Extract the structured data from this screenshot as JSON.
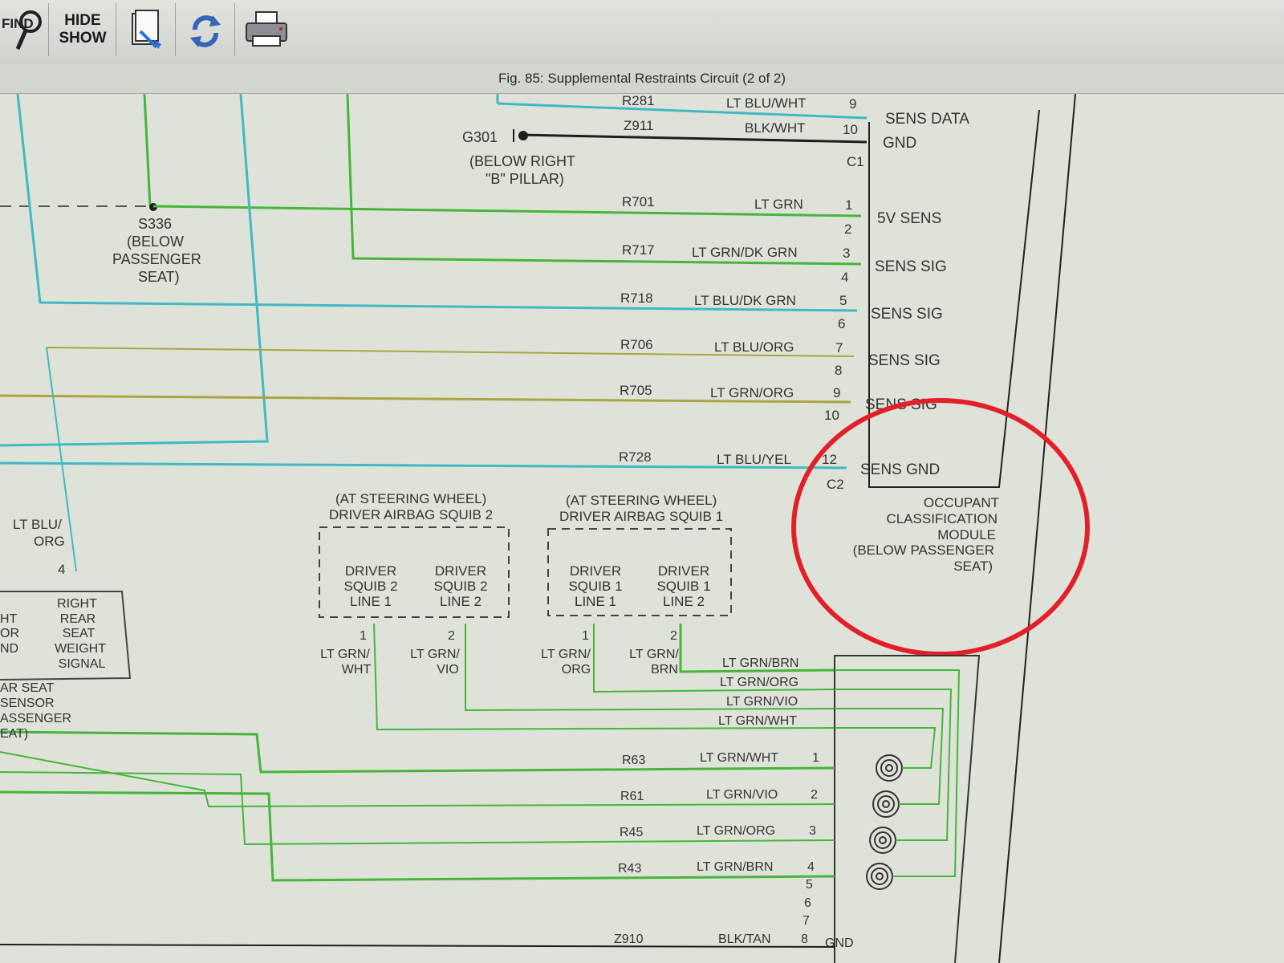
{
  "toolbar": {
    "find_label": "FIND",
    "hide_label": "HIDE",
    "show_label": "SHOW"
  },
  "figure_title": "Fig. 85: Supplemental Restraints Circuit (2 of 2)",
  "colors": {
    "wire_green": "#46b53a",
    "wire_cyan": "#3fb9c2",
    "wire_olive": "#a9a542",
    "wire_black": "#1d1d1d",
    "highlight_red": "#e2202a"
  },
  "connector_c1": {
    "label": "C1",
    "pins": [
      {
        "wire": "R281",
        "color": "LT BLU/WHT",
        "pin": "9",
        "signal": "SENS DATA"
      },
      {
        "wire": "Z911",
        "color": "BLK/WHT",
        "pin": "10",
        "signal": "GND"
      }
    ]
  },
  "connector_c2": {
    "label": "C2",
    "pins": [
      {
        "wire": "R701",
        "color": "LT GRN",
        "pin": "1",
        "signal": "5V SENS"
      },
      {
        "pin": "2"
      },
      {
        "wire": "R717",
        "color": "LT GRN/DK GRN",
        "pin": "3",
        "signal": "SENS SIG"
      },
      {
        "pin": "4"
      },
      {
        "wire": "R718",
        "color": "LT BLU/DK GRN",
        "pin": "5",
        "signal": "SENS SIG"
      },
      {
        "pin": "6"
      },
      {
        "wire": "R706",
        "color": "LT BLU/ORG",
        "pin": "7",
        "signal": "SENS SIG"
      },
      {
        "pin": "8"
      },
      {
        "wire": "R705",
        "color": "LT GRN/ORG",
        "pin": "9",
        "signal": "SENS SIG"
      },
      {
        "pin": "10"
      },
      {
        "wire": "R728",
        "color": "LT BLU/YEL",
        "pin": "12",
        "signal": "SENS GND"
      }
    ]
  },
  "ground_g301": {
    "id": "G301",
    "loc1": "(BELOW RIGHT",
    "loc2": "\"B\" PILLAR)"
  },
  "splice_s336": {
    "id": "S336",
    "l1": "(BELOW",
    "l2": "PASSENGER",
    "l3": "SEAT)"
  },
  "occupant_module": {
    "l1": "OCCUPANT",
    "l2": "CLASSIFICATION",
    "l3": "MODULE",
    "l4": "(BELOW PASSENGER",
    "l5": "SEAT)"
  },
  "squib2": {
    "location": "(AT STEERING WHEEL)",
    "name": "DRIVER AIRBAG SQUIB 2",
    "line1": [
      "DRIVER",
      "SQUIB 2",
      "LINE 1"
    ],
    "line2": [
      "DRIVER",
      "SQUIB 2",
      "LINE 2"
    ],
    "pin1": "1",
    "pin2": "2",
    "wire1": [
      "LT GRN/",
      "WHT"
    ],
    "wire2": [
      "LT GRN/",
      "VIO"
    ]
  },
  "squib1": {
    "location": "(AT STEERING WHEEL)",
    "name": "DRIVER AIRBAG SQUIB 1",
    "line1": [
      "DRIVER",
      "SQUIB 1",
      "LINE 1"
    ],
    "line2": [
      "DRIVER",
      "SQUIB 1",
      "LINE 2"
    ],
    "pin1": "1",
    "pin2": "2",
    "wire1": [
      "LT GRN/",
      "ORG"
    ],
    "wire2": [
      "LT GRN/",
      "BRN"
    ]
  },
  "clockspring_labels": [
    "LT GRN/BRN",
    "LT GRN/ORG",
    "LT GRN/VIO",
    "LT GRN/WHT"
  ],
  "clockspring_pins": [
    {
      "wire": "R63",
      "color": "LT GRN/WHT",
      "pin": "1"
    },
    {
      "wire": "R61",
      "color": "LT GRN/VIO",
      "pin": "2"
    },
    {
      "wire": "R45",
      "color": "LT GRN/ORG",
      "pin": "3"
    },
    {
      "wire": "R43",
      "color": "LT GRN/BRN",
      "pin": "4"
    },
    {
      "pin": "5"
    },
    {
      "pin": "6"
    },
    {
      "pin": "7"
    },
    {
      "wire": "Z910",
      "color": "BLK/TAN",
      "pin": "8",
      "signal": "GND"
    }
  ],
  "left_sensor": {
    "wire_l1": "LT BLU/",
    "wire_l2": "ORG",
    "pin": "4",
    "right_rear": [
      "RIGHT",
      "REAR",
      "SEAT",
      "WEIGHT",
      "SIGNAL"
    ],
    "left_partial": [
      "HT",
      "OR",
      "ND"
    ],
    "bottom_partial": [
      "AR SEAT",
      "SENSOR",
      "ASSENGER",
      "EAT)"
    ]
  }
}
